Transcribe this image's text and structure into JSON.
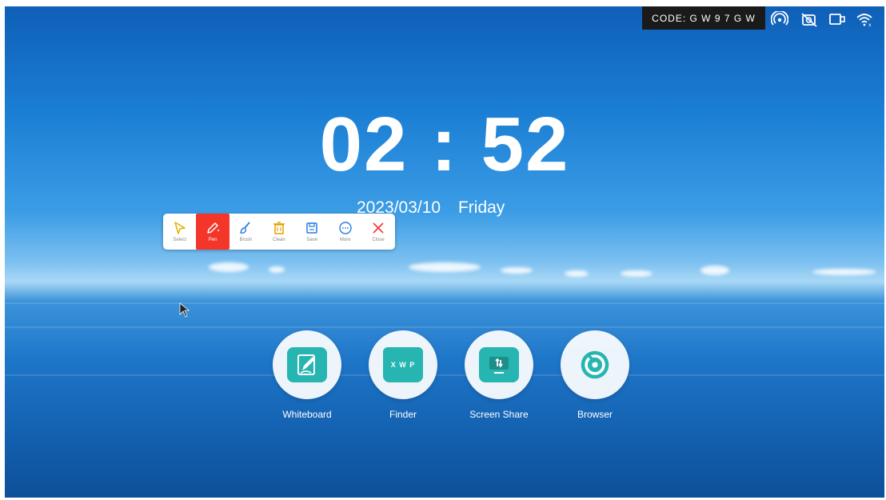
{
  "status_bar": {
    "code_text": "CODE: G W 9 7 G W",
    "icons": [
      "hotspot-icon",
      "camera-off-icon",
      "screen-mirror-icon",
      "wifi-icon"
    ]
  },
  "clock": {
    "time": "02 : 52",
    "date": "2023/03/10",
    "weekday": "Friday"
  },
  "toolbar": {
    "tools": [
      {
        "label": "Select",
        "icon": "cursor-select-icon",
        "color": "#e0b400"
      },
      {
        "label": "Pen",
        "icon": "pen-icon",
        "color": "#ffffff",
        "active": true
      },
      {
        "label": "Brush",
        "icon": "brush-icon",
        "color": "#2a7be0"
      },
      {
        "label": "Clean",
        "icon": "trash-icon",
        "color": "#e0a400"
      },
      {
        "label": "Save",
        "icon": "save-icon",
        "color": "#2a7be0"
      },
      {
        "label": "More",
        "icon": "more-icon",
        "color": "#2a7be0"
      },
      {
        "label": "Close",
        "icon": "close-icon",
        "color": "#f4362a"
      }
    ]
  },
  "apps": [
    {
      "label": "Whiteboard",
      "icon": "whiteboard-icon"
    },
    {
      "label": "Finder",
      "icon": "folder-icon",
      "badge": "X W P"
    },
    {
      "label": "Screen Share",
      "icon": "screen-share-icon"
    },
    {
      "label": "Browser",
      "icon": "browser-icon"
    }
  ],
  "colors": {
    "accent": "#26b5b0",
    "pen_active": "#f4362a"
  }
}
